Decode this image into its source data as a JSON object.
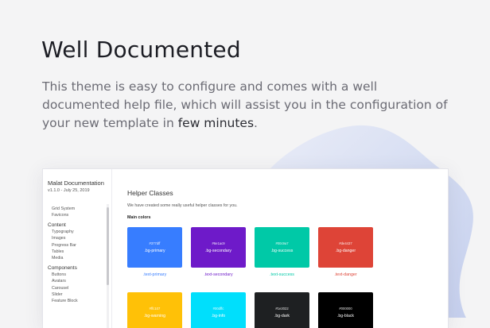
{
  "hero": {
    "title": "Well Documented",
    "description_prefix": "This theme is easy to configure and comes with a well documented help file, which will assist you in the configuration of your new template in ",
    "description_highlight": "few minutes",
    "description_suffix": "."
  },
  "docs": {
    "sidebar": {
      "title": "Malat Documentation",
      "version": "v1.1.0 - July 25, 2019",
      "groups": [
        {
          "heading": "",
          "items": [
            "Grid System",
            "Favicons"
          ]
        },
        {
          "heading": "Content",
          "items": [
            "Typography",
            "Images",
            "Progress Bar",
            "Tables",
            "Media"
          ]
        },
        {
          "heading": "Components",
          "items": [
            "Buttons",
            "Avatars",
            "Carousel",
            "Slider",
            "Feature Block"
          ]
        }
      ]
    },
    "main": {
      "title": "Helper Classes",
      "description": "We have created some really useful helper classes for you.",
      "subtitle": "Main colors",
      "colors": [
        {
          "hex": "#377dff",
          "class": ".bg-primary",
          "text": ".text-primary",
          "color": "#377dff"
        },
        {
          "hex": "#6e1ac9",
          "class": ".bg-secondary",
          "text": ".text-secondary",
          "color": "#6e1ac9"
        },
        {
          "hex": "#00c9a7",
          "class": ".bg-success",
          "text": ".text-success",
          "color": "#00c9a7"
        },
        {
          "hex": "#de4437",
          "class": ".bg-danger",
          "text": ".text-danger",
          "color": "#de4437"
        },
        {
          "hex": "#ffc107",
          "class": ".bg-warning",
          "text": "",
          "color": "#ffc107"
        },
        {
          "hex": "#00dffc",
          "class": ".bg-info",
          "text": "",
          "color": "#00dffc"
        },
        {
          "hex": "#1e2022",
          "class": ".bg-dark",
          "text": "",
          "color": "#1e2022"
        },
        {
          "hex": "#000000",
          "class": ".bg-black",
          "text": "",
          "color": "#000000"
        }
      ]
    }
  }
}
